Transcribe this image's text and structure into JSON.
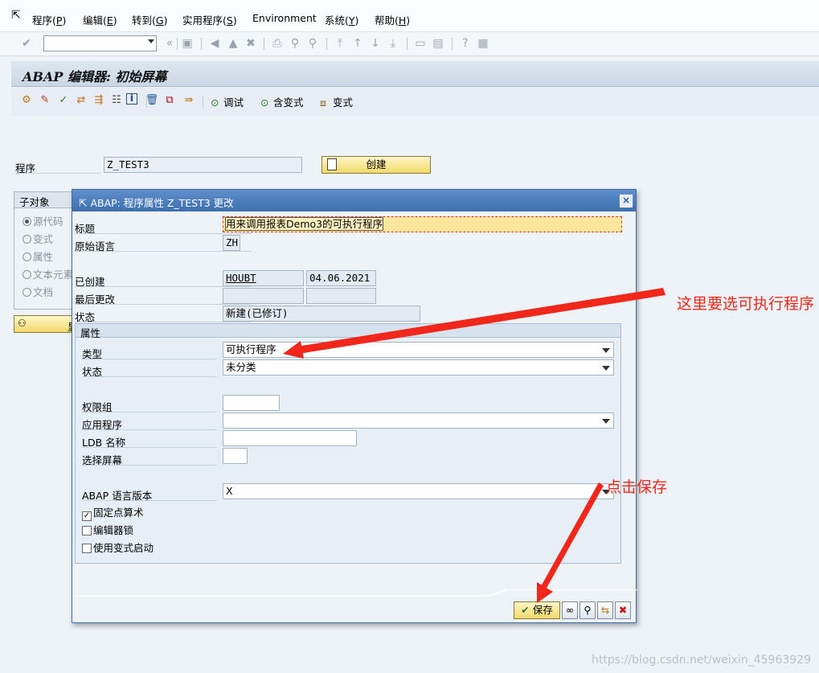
{
  "menu": {
    "items": [
      {
        "label": "程序(",
        "key": "P",
        "tail": ")"
      },
      {
        "label": "编辑(",
        "key": "E",
        "tail": ")"
      },
      {
        "label": "转到(",
        "key": "G",
        "tail": ")"
      },
      {
        "label": "实用程序(",
        "key": "S",
        "tail": ")"
      },
      {
        "label": "Environment",
        "key": "",
        "tail": ""
      },
      {
        "label": "系统(",
        "key": "Y",
        "tail": ")"
      },
      {
        "label": "帮助(",
        "key": "H",
        "tail": ")"
      }
    ]
  },
  "screen": {
    "title": "ABAP 编辑器: 初始屏幕"
  },
  "app_toolbar": {
    "debug": "调试",
    "with_variant": "含变式",
    "variant": "变式"
  },
  "main": {
    "program_label": "程序",
    "program_value": "Z_TEST3",
    "create_label": "创建",
    "subobjects": {
      "header": "子对象",
      "items": [
        "源代码",
        "变式",
        "属性",
        "文本元素",
        "文档"
      ],
      "display_label": "显"
    }
  },
  "dialog": {
    "title": "ABAP: 程序属性 Z_TEST3 更改",
    "close": "×",
    "title_label": "标题",
    "title_value": "用来调用报表Demo3的可执行程序",
    "orig_lang_label": "原始语言",
    "orig_lang_value": "ZH",
    "created_label": "已创建",
    "created_user": "HOUBT",
    "created_date": "04.06.2021",
    "last_changed_label": "最后更改",
    "status_label": "状态",
    "status_value": "新建(已修订)",
    "attributes": {
      "header": "属性",
      "type_label": "类型",
      "type_value": "可执行程序",
      "status_label": "状态",
      "status_value": "未分类",
      "auth_group_label": "权限组",
      "application_label": "应用程序",
      "ldb_label": "LDB 名称",
      "sel_screen_label": "选择屏幕",
      "abap_version_label": "ABAP 语言版本",
      "abap_version_value": "X",
      "fixed_point_label": "固定点算术",
      "editor_lock_label": "编辑器锁",
      "variant_start_label": "使用变式启动"
    },
    "save_label": "保存"
  },
  "annotations": {
    "type_note": "这里要选可执行程序",
    "save_note": "点击保存"
  },
  "watermark": "https://blog.csdn.net/weixin_45963929",
  "colors": {
    "annotation": "#f0271a",
    "dialog_title": "#3d6fb0",
    "button_yellow": "#f2d96a"
  }
}
